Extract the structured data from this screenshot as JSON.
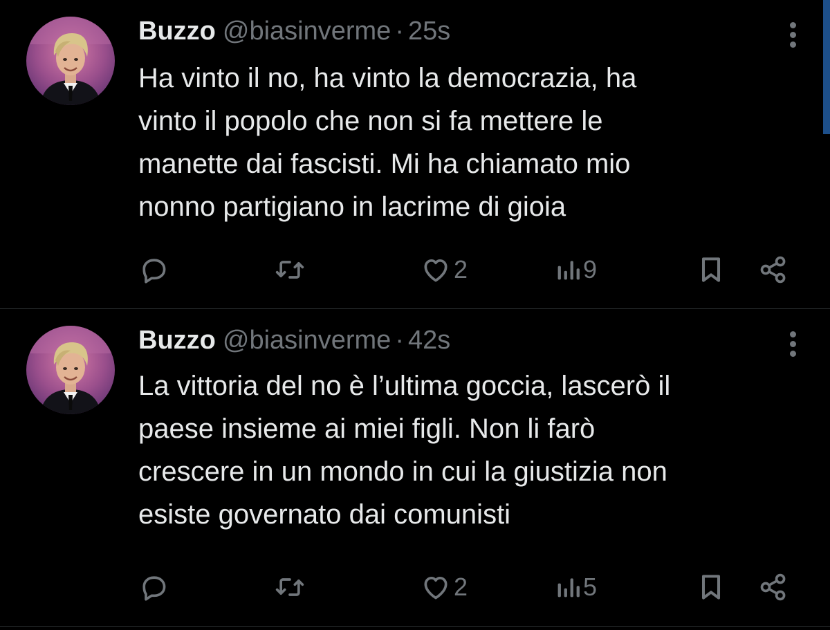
{
  "tweets": [
    {
      "author": {
        "name": "Buzzo",
        "handle": "@biasinverme"
      },
      "separator": "·",
      "time": "25s",
      "text": "Ha vinto il no, ha vinto la democrazia, ha\nvinto il popolo che non si fa mettere le\nmanette dai fascisti. Mi ha chiamato mio\nnonno partigiano in lacrime di gioia",
      "stats": {
        "replies": "",
        "retweets": "",
        "likes": "2",
        "views": "9"
      }
    },
    {
      "author": {
        "name": "Buzzo",
        "handle": "@biasinverme"
      },
      "separator": "·",
      "time": "42s",
      "text": "La vittoria del no è l’ultima goccia, lascerò il\npaese insieme ai miei figli. Non li farò\ncrescere in un mondo in cui la giustizia non\nesiste governato dai comunisti",
      "stats": {
        "replies": "",
        "retweets": "",
        "likes": "2",
        "views": "5"
      }
    }
  ],
  "icons": {
    "more": "more-vertical-icon",
    "reply": "reply-icon",
    "retweet": "retweet-icon",
    "like": "heart-icon",
    "views": "analytics-icon",
    "bookmark": "bookmark-icon",
    "share": "share-icon"
  },
  "colors": {
    "background": "#000000",
    "text_primary": "#e7e9ea",
    "text_secondary": "#71767b",
    "divider": "#2f3336",
    "scroll_accent": "#1d4f8a"
  }
}
